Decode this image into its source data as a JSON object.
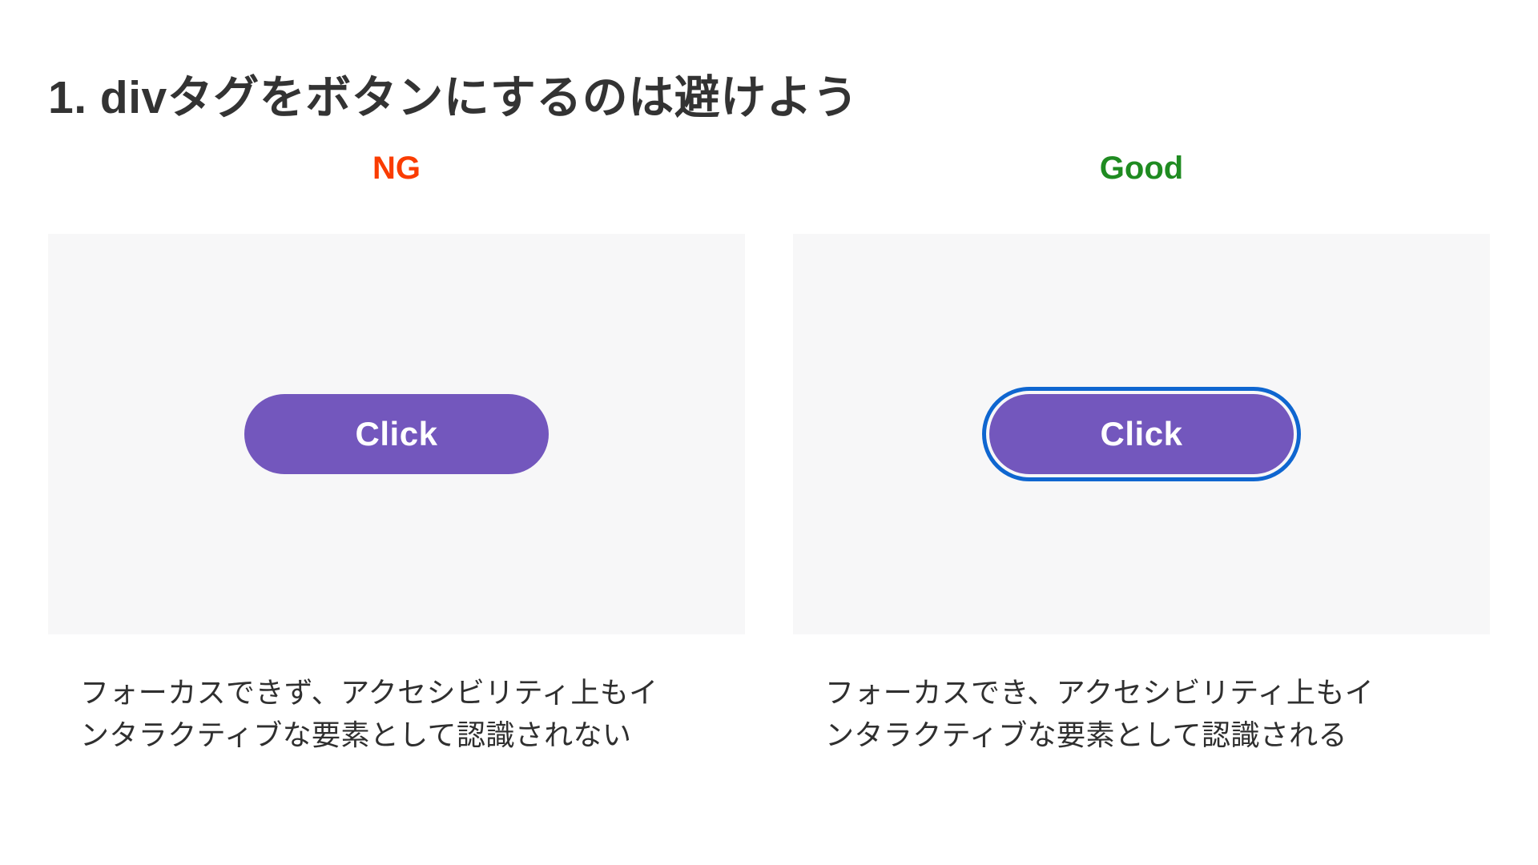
{
  "slide": {
    "title": "1. divタグをボタンにするのは避けよう",
    "title_color": "#333333",
    "background": "#ffffff"
  },
  "columns": [
    {
      "verdict_label": "NG",
      "verdict_color": "#fa3c00",
      "stage_background": "#f7f7f8",
      "button": {
        "label": "Click",
        "background_color": "#7357bd",
        "text_color": "#ffffff",
        "focused": false,
        "focus_ring_color": ""
      },
      "caption": {
        "line1": "フォーカスできず、アクセシビリティ上もイ",
        "line2": "ンタラクティブな要素として認識されない"
      }
    },
    {
      "verdict_label": "Good",
      "verdict_color": "#1f8b21",
      "stage_background": "#f7f7f8",
      "button": {
        "label": "Click",
        "background_color": "#7357bd",
        "text_color": "#ffffff",
        "focused": true,
        "focus_ring_color": "#0f66d0"
      },
      "caption": {
        "line1": "フォーカスでき、アクセシビリティ上もイ",
        "line2": "ンタラクティブな要素として認識される"
      }
    }
  ]
}
